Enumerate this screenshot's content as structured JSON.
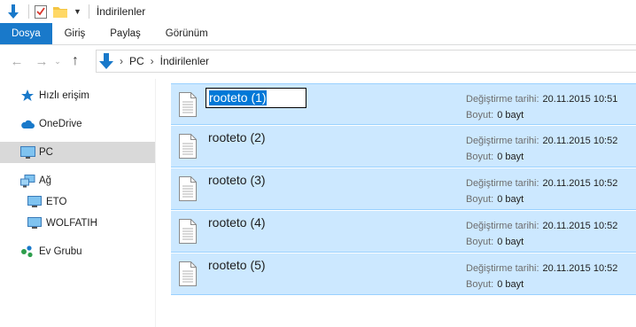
{
  "window": {
    "title": "İndirilenler"
  },
  "ribbon": {
    "tabs": [
      "Dosya",
      "Giriş",
      "Paylaş",
      "Görünüm"
    ]
  },
  "address": {
    "crumbs": [
      "PC",
      "İndirilenler"
    ]
  },
  "nav": {
    "items": [
      {
        "label": "Hızlı erişim",
        "icon": "star-icon"
      },
      {
        "label": "OneDrive",
        "icon": "cloud-icon"
      },
      {
        "label": "PC",
        "icon": "computer-icon",
        "selected": true
      },
      {
        "label": "Ağ",
        "icon": "network-icon"
      },
      {
        "label": "ETO",
        "icon": "monitor-icon"
      },
      {
        "label": "WOLFATIH",
        "icon": "monitor-icon"
      },
      {
        "label": "Ev Grubu",
        "icon": "homegroup-icon"
      }
    ]
  },
  "files": [
    {
      "name": "rooteto (1)",
      "date_label": "Değiştirme tarihi:",
      "date": "20.11.2015 10:51",
      "size_label": "Boyut:",
      "size": "0 bayt",
      "renaming": true
    },
    {
      "name": "rooteto (2)",
      "date_label": "Değiştirme tarihi:",
      "date": "20.11.2015 10:52",
      "size_label": "Boyut:",
      "size": "0 bayt"
    },
    {
      "name": "rooteto (3)",
      "date_label": "Değiştirme tarihi:",
      "date": "20.11.2015 10:52",
      "size_label": "Boyut:",
      "size": "0 bayt"
    },
    {
      "name": "rooteto (4)",
      "date_label": "Değiştirme tarihi:",
      "date": "20.11.2015 10:52",
      "size_label": "Boyut:",
      "size": "0 bayt"
    },
    {
      "name": "rooteto (5)",
      "date_label": "Değiştirme tarihi:",
      "date": "20.11.2015 10:52",
      "size_label": "Boyut:",
      "size": "0 bayt"
    }
  ],
  "colors": {
    "accent": "#1979ca",
    "selection": "#cce8ff",
    "selection_border": "#99d1ff",
    "rename_highlight": "#0078d7"
  }
}
